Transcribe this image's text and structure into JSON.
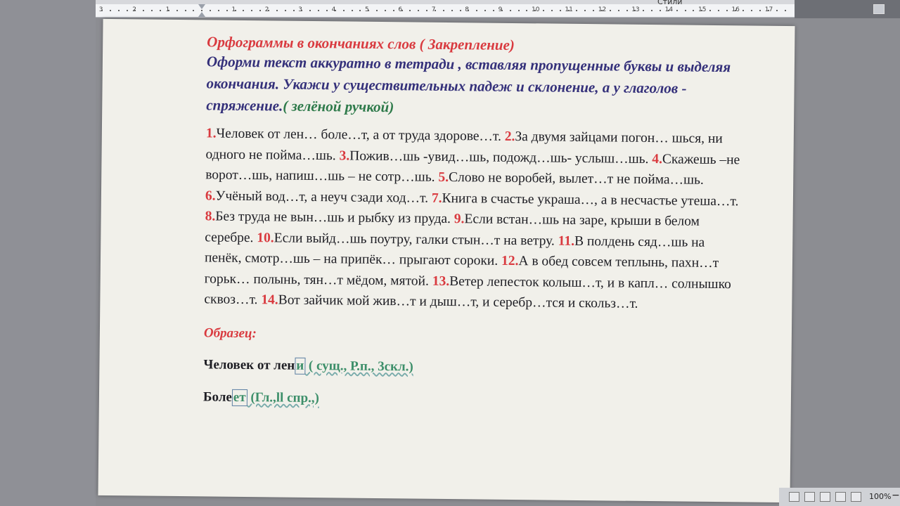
{
  "ruler": {
    "styles_label": "Стили",
    "left_marks": [
      "3",
      "2",
      "1"
    ],
    "right_marks": [
      "1",
      "2",
      "3",
      "4",
      "5",
      "6",
      "7",
      "8",
      "9",
      "10",
      "11",
      "12",
      "13",
      "14",
      "15",
      "16",
      "17"
    ]
  },
  "document": {
    "title": "Орфограммы в окончаниях слов ( Закрепление)",
    "instruction_main": "Оформи текст аккуратно в тетради , вставляя пропущенные буквы и выделяя окончания. Укажи у существительных падеж и склонение, а у глаголов - спряжение.",
    "instruction_green": "( зелёной ручкой)",
    "sentences": [
      {
        "num": "1.",
        "text": "Человек от лен… боле…т, а от труда здорове…т."
      },
      {
        "num": "2.",
        "text": "За двумя зайцами погон… шься, ни одного не пойма…шь."
      },
      {
        "num": "3.",
        "text": "Пожив…шь -увид…шь, подожд…шь- услыш…шь."
      },
      {
        "num": "4.",
        "text": "Скажешь –не ворот…шь, напиш…шь – не сотр…шь."
      },
      {
        "num": "5.",
        "text": "Слово не воробей, вылет…т не пойма…шь."
      },
      {
        "num": "6.",
        "text": "Учёный вод…т, а неуч сзади ход…т."
      },
      {
        "num": "7.",
        "text": "Книга в счастье украша…, а в несчастье утеша…т."
      },
      {
        "num": "8.",
        "text": "Без труда  не вын…шь и рыбку из пруда."
      },
      {
        "num": "9.",
        "text": "Если встан…шь на заре, крыши в белом серебре."
      },
      {
        "num": "10.",
        "text": "Если выйд…шь поутру, галки стын…т на ветру."
      },
      {
        "num": "11.",
        "text": "В полдень сяд…шь на пенёк, смотр…шь – на припёк… прыгают сороки."
      },
      {
        "num": "12.",
        "text": "А в обед совсем теплынь, пахн…т горьк…   полынь, тян…т мёдом, мятой."
      },
      {
        "num": "13.",
        "text": "Ветер лепесток колыш…т, и в капл… солнышко сквоз…т."
      },
      {
        "num": "14.",
        "text": "Вот зайчик мой жив…т и дыш…т, и серебр…тся и скольз…т."
      }
    ],
    "sample_label": "Образец:",
    "sample1": {
      "word_stem": "Человек от лен",
      "ending": "и",
      "note": " ( сущ., Р.п., 3скл.)"
    },
    "sample2": {
      "word_stem": "Боле",
      "ending": "ет",
      "note": " (Гл.,ll  спр.,)"
    }
  },
  "statusbar": {
    "zoom": "100%",
    "minus": "−"
  }
}
